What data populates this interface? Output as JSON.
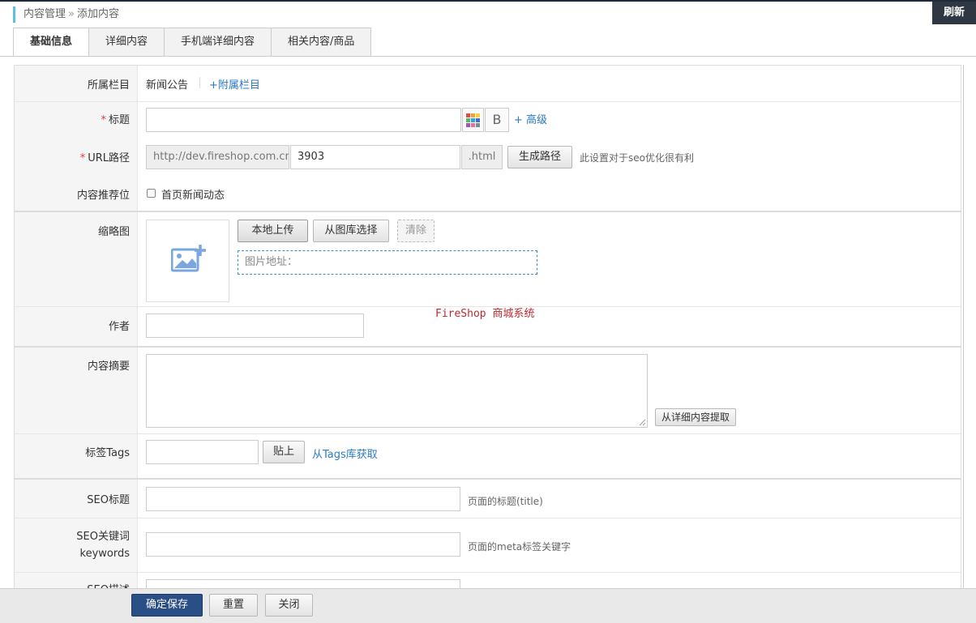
{
  "breadcrumb": {
    "parent": "内容管理",
    "separator": "»",
    "current": "添加内容"
  },
  "refresh_label": "刷新",
  "tabs": [
    {
      "label": "基础信息",
      "active": true
    },
    {
      "label": "详细内容",
      "active": false
    },
    {
      "label": "手机端详细内容",
      "active": false
    },
    {
      "label": "相关内容/商品",
      "active": false
    }
  ],
  "form": {
    "category": {
      "label": "所属栏目",
      "value": "新闻公告",
      "extra_link": "+附属栏目"
    },
    "title": {
      "required_mark": "*",
      "label": "标题",
      "value": "",
      "bold_label": "B",
      "advanced_link": "+ 高级"
    },
    "url": {
      "required_mark": "*",
      "label": "URL路径",
      "prefix": "http://dev.fireshop.com.cn",
      "value": "3903",
      "suffix": ".html",
      "generate_label": "生成路径",
      "hint": "此设置对于seo优化很有利"
    },
    "recommend": {
      "label": "内容推荐位",
      "option_label": "首页新闻动态",
      "checked": false
    },
    "thumbnail": {
      "label": "缩略图",
      "upload_label": "本地上传",
      "gallery_label": "从图库选择",
      "clear_label": "清除",
      "address_placeholder": "图片地址："
    },
    "author": {
      "label": "作者",
      "value": ""
    },
    "summary": {
      "label": "内容摘要",
      "value": "",
      "extract_label": "从详细内容提取"
    },
    "tags": {
      "label": "标签Tags",
      "value": "",
      "paste_label": "贴上",
      "library_link": "从Tags库获取"
    },
    "seo_title": {
      "label": "SEO标题",
      "value": "",
      "hint": "页面的标题(title)"
    },
    "seo_keywords": {
      "label_line1": "SEO关键词",
      "label_line2": "keywords",
      "value": "",
      "hint": "页面的meta标签关键字"
    },
    "seo_description": {
      "label": "SEO描述"
    }
  },
  "watermark": "FireShop 商城系统",
  "footer": {
    "save_label": "确定保存",
    "reset_label": "重置",
    "close_label": "关闭"
  },
  "colors": {
    "accent": "#5bc0de",
    "primary": "#2a4f86",
    "required": "#e23a3a",
    "link": "#2a7ac6"
  }
}
